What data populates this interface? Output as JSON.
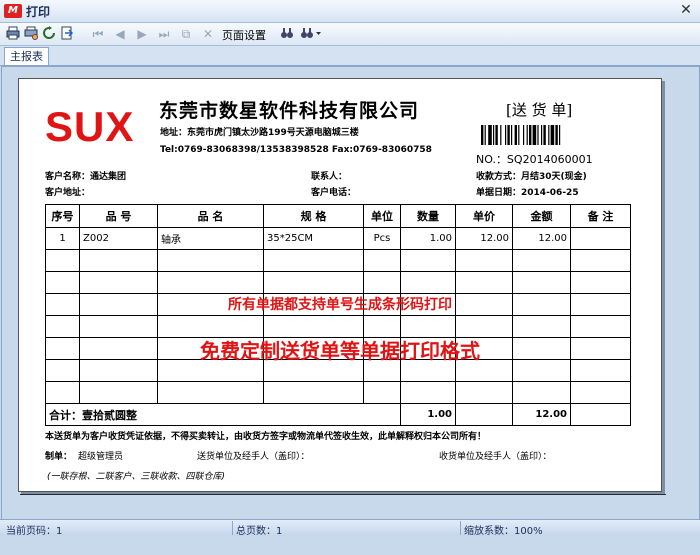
{
  "window": {
    "title": "打印",
    "logo_letter": "M",
    "close": "✕"
  },
  "toolbar": {
    "page_setup": "页面设置"
  },
  "tabs": [
    {
      "label": "主报表"
    }
  ],
  "document": {
    "logo": "SUX",
    "company": "东莞市数星软件科技有限公司",
    "address": "地址：东莞市虎门镇太沙路199号天源电脑城三楼",
    "tel": "Tel:0769-83068398/13538398528  Fax:0769-83060758",
    "doc_title": "[送 货 单]",
    "doc_no": "NO.：SQ2014060001",
    "customer_name_label": "客户名称：",
    "customer_name": "通达集团",
    "contact_label": "联系人：",
    "contact": "",
    "payment_label": "收款方式：",
    "payment": "月结30天(现金)",
    "customer_addr_label": "客户地址：",
    "customer_addr": "",
    "customer_phone_label": "客户电话：",
    "customer_phone": "",
    "date_label": "单据日期：",
    "date": "2014-06-25",
    "headers": [
      "序号",
      "品 号",
      "品 名",
      "规 格",
      "单位",
      "数量",
      "单价",
      "金额",
      "备 注"
    ],
    "rows": [
      {
        "no": "1",
        "code": "Z002",
        "name": "轴承",
        "spec": "35*25CM",
        "unit": "Pcs",
        "qty": "1.00",
        "price": "12.00",
        "amount": "12.00",
        "remark": ""
      }
    ],
    "empty_rows": 7,
    "total_label": "合计：壹拾贰圆整",
    "total_qty": "1.00",
    "total_amount": "12.00",
    "promo_1": "所有单据都支持单号生成条形码打印",
    "promo_2": "免费定制送货单等单据打印格式",
    "notice": "本送货单为客户收货凭证依据，不得买卖转让，由收货方签字或物流单代签收生效，此单解释权归本公司所有！",
    "maker_label": "制单：",
    "maker": "超级管理员",
    "sender_label": "送货单位及经手人（盖印）：",
    "receiver_label": "收货单位及经手人（盖印）：",
    "copies": "(一联存根、二联客户、三联收款、四联仓库)"
  },
  "status": {
    "current_page": "当前页码：1",
    "total_pages": "总页数：1",
    "zoom": "缩放系数：100%"
  },
  "colors": {
    "accent_red": "#e01414",
    "chrome_blue": "#c9d9ec"
  }
}
